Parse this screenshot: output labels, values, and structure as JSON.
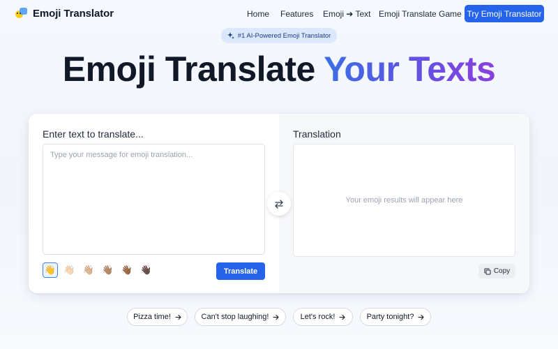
{
  "brand": {
    "name": "Emoji Translator",
    "logo_icon": "emoji-logo-icon"
  },
  "nav": {
    "items": [
      "Home",
      "Features",
      "Emoji ➜ Text",
      "Emoji Translate Game"
    ],
    "cta_label": "Try Emoji Translator"
  },
  "badge": {
    "label": "#1 AI-Powered Emoji Translator",
    "icon": "sparkle-icon"
  },
  "hero": {
    "title_part1": "Emoji Translate ",
    "title_part2": "Your Texts"
  },
  "translator": {
    "input_label": "Enter text to translate...",
    "input_placeholder": "Type your message for emoji translation...",
    "input_value": "",
    "output_label": "Translation",
    "output_placeholder": "Your emoji results will appear here",
    "skin_tones": [
      "👋",
      "👋🏻",
      "👋🏼",
      "👋🏽",
      "👋🏾",
      "👋🏿"
    ],
    "selected_tone_index": 0,
    "translate_label": "Translate",
    "copy_label": "Copy",
    "swap_icon": "swap-arrows-icon"
  },
  "suggestions": [
    "Pizza time!",
    "Can't stop laughing!",
    "Let's rock!",
    "Party tonight?"
  ],
  "colors": {
    "accent": "#2563eb",
    "hero_gradient": [
      "#3b6fe3",
      "#8b3fdc"
    ],
    "badge_bg": "#dbe8fb"
  }
}
